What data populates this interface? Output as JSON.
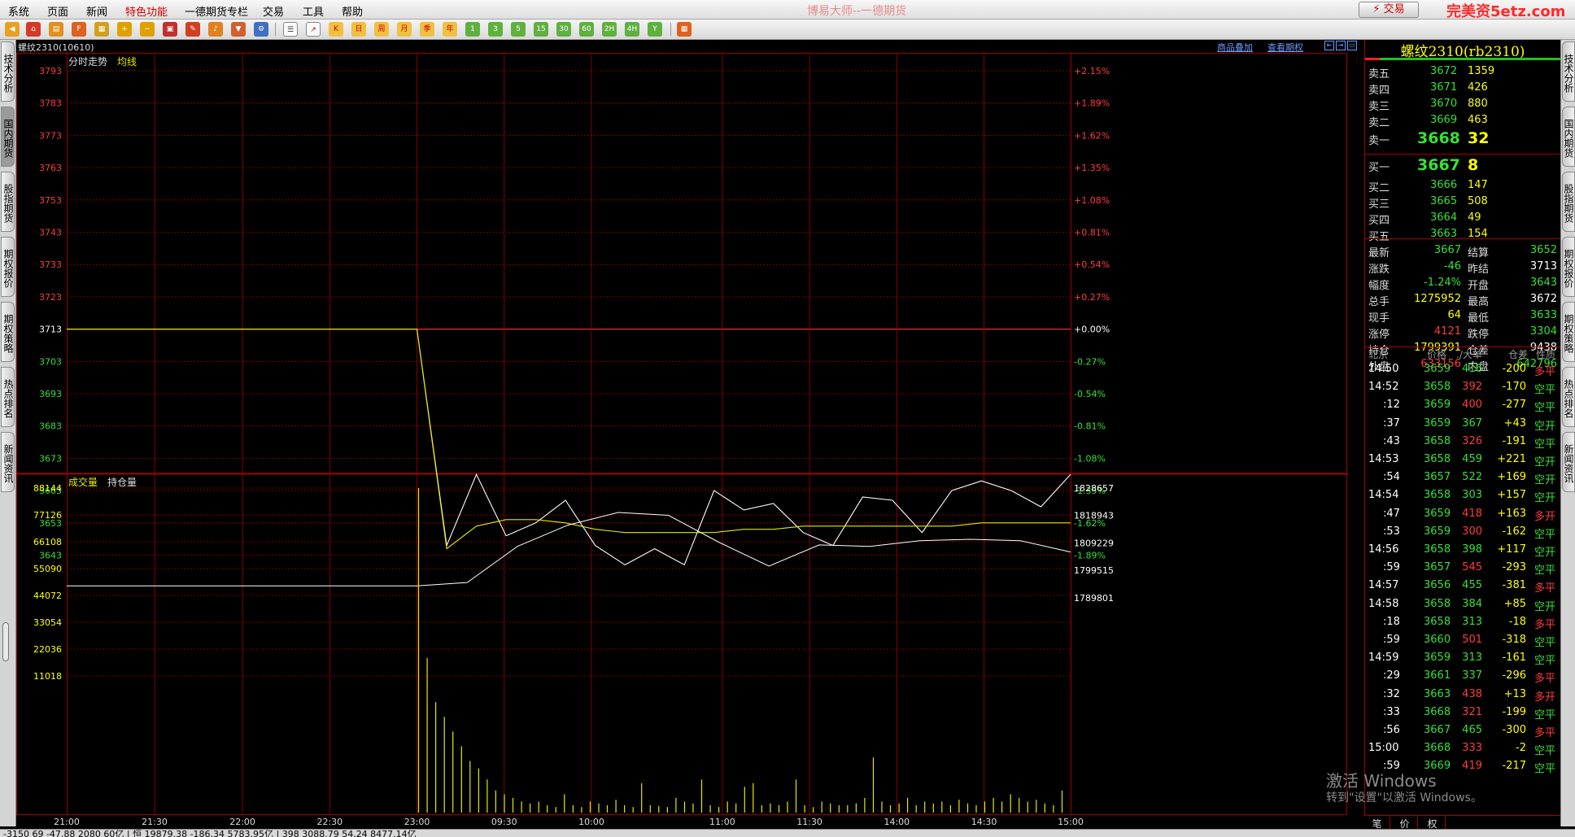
{
  "window": {
    "title": "博易大师--一德期货",
    "trade_button": "⚡ 交易",
    "watermark": "完美资5etz.com"
  },
  "menu": [
    "系统",
    "页面",
    "新闻",
    "特色功能",
    "一德期货专栏",
    "交易",
    "工具",
    "帮助"
  ],
  "toolbar": {
    "period_buttons": [
      "日",
      "周",
      "月",
      "季",
      "年",
      "1",
      "3",
      "5",
      "15",
      "30",
      "60",
      "2H",
      "4H",
      "Y"
    ]
  },
  "left_tabs": [
    "技术分析",
    "国内期货",
    "股指期货",
    "期权报价",
    "期权策略",
    "热点排名",
    "新闻资讯"
  ],
  "right_tabs": [
    "技术分析",
    "国内期货",
    "股指期货",
    "期权报价",
    "期权策略",
    "热点排名",
    "新闻资讯"
  ],
  "chart": {
    "symbol_label": "螺纹2310(10610)",
    "links": [
      "商品叠加",
      "查看期权"
    ],
    "price_panel": {
      "legend": [
        "分时走势",
        "均线"
      ],
      "left_ticks": [
        "3793",
        "3783",
        "3773",
        "3763",
        "3753",
        "3743",
        "3733",
        "3723",
        "3713",
        "3703",
        "3693",
        "3683",
        "3673",
        "3663",
        "3653",
        "3643"
      ],
      "right_ticks": [
        "+2.15%",
        "+1.89%",
        "+1.62%",
        "+1.35%",
        "+1.08%",
        "+0.81%",
        "+0.54%",
        "+0.27%",
        "+0.00%",
        "-0.27%",
        "-0.54%",
        "-0.81%",
        "-1.08%",
        "-1.35%",
        "-1.62%",
        "-1.89%"
      ],
      "prev_settle": 3713
    },
    "volume_panel": {
      "legend": [
        "成交量",
        "持仓量"
      ],
      "left_ticks": [
        "88144",
        "77126",
        "66108",
        "55090",
        "44072",
        "33054",
        "22036",
        "11018"
      ],
      "right_ticks": [
        "1828657",
        "1818943",
        "1809229",
        "1799515",
        "1789801"
      ]
    },
    "time_ticks": [
      "21:00",
      "21:30",
      "22:00",
      "22:30",
      "23:00",
      "09:30",
      "10:00",
      "11:00",
      "11:30",
      "14:00",
      "14:30",
      "15:00"
    ]
  },
  "chart_data": {
    "type": "line",
    "title": "",
    "x_categories": [
      "21:00",
      "21:30",
      "22:00",
      "22:30",
      "23:00",
      "09:30",
      "10:00",
      "11:00",
      "11:30",
      "14:00",
      "14:30",
      "15:00"
    ],
    "series": [
      {
        "name": "分时走势",
        "values": [
          3713,
          3713,
          3713,
          3713,
          3713,
          3646,
          3668,
          3649,
          3653,
          3660,
          3646,
          3640,
          3645,
          3640,
          3663,
          3657,
          3659,
          3650,
          3646,
          3661,
          3660,
          3650,
          3663,
          3666,
          3663,
          3658,
          3668
        ]
      },
      {
        "name": "均线",
        "values": [
          3713,
          3713,
          3713,
          3713,
          3713,
          3645,
          3652,
          3654,
          3654,
          3653,
          3651,
          3650,
          3650,
          3650,
          3650,
          3651,
          3651,
          3652,
          3652,
          3652,
          3652,
          3652,
          3652,
          3653,
          3653,
          3653,
          3653
        ]
      },
      {
        "name": "持仓量",
        "values": [
          1794000,
          1794000,
          1794000,
          1794000,
          1794000,
          1795200,
          1808000,
          1815500,
          1820000,
          1819000,
          1809500,
          1801000,
          1808500,
          1808000,
          1810000,
          1810500,
          1810000,
          1806000
        ]
      }
    ],
    "volume_bars": [
      88144,
      42000,
      30000,
      26000,
      22000,
      18000,
      14000,
      12000,
      9000,
      6000,
      5000,
      4000,
      3000,
      2500,
      3000,
      2000,
      1500,
      5000,
      2000,
      1500,
      3000,
      2500,
      2000,
      3500,
      2000,
      1500,
      8000,
      2000,
      1800,
      1500,
      4000,
      3000,
      2500,
      9000,
      2000,
      1500,
      3000,
      2500,
      7000,
      8000,
      2000,
      2500,
      2000,
      3000,
      9000,
      2000,
      1500,
      3000,
      2500,
      2000,
      2000,
      2500,
      4000,
      15000,
      3000,
      2000,
      2500,
      4000,
      2000,
      3000,
      2500,
      3000,
      2000,
      3500,
      2500,
      2000,
      3000,
      4000,
      3000,
      5000,
      4000,
      3000,
      3500,
      2500,
      2000,
      6000
    ],
    "price_ylim": [
      3640,
      3793
    ],
    "volume_ylim": [
      0,
      88144
    ],
    "oi_ylim": [
      1789801,
      1828657
    ]
  },
  "quote": {
    "title": "螺纹2310(rb2310)",
    "asks": [
      {
        "label": "卖五",
        "price": "3672",
        "vol": "1359"
      },
      {
        "label": "卖四",
        "price": "3671",
        "vol": "426"
      },
      {
        "label": "卖三",
        "price": "3670",
        "vol": "880"
      },
      {
        "label": "卖二",
        "price": "3669",
        "vol": "463"
      },
      {
        "label": "卖一",
        "price": "3668",
        "vol": "32"
      }
    ],
    "bids": [
      {
        "label": "买一",
        "price": "3667",
        "vol": "8"
      },
      {
        "label": "买二",
        "price": "3666",
        "vol": "147"
      },
      {
        "label": "买三",
        "price": "3665",
        "vol": "508"
      },
      {
        "label": "买四",
        "price": "3664",
        "vol": "49"
      },
      {
        "label": "买五",
        "price": "3663",
        "vol": "154"
      }
    ],
    "stats": [
      {
        "l1": "最新",
        "v1": "3667",
        "l2": "结算",
        "v2": "3652"
      },
      {
        "l1": "涨跌",
        "v1": "-46",
        "l2": "昨结",
        "v2": "3713"
      },
      {
        "l1": "幅度",
        "v1": "-1.24%",
        "l2": "开盘",
        "v2": "3643"
      },
      {
        "l1": "总手",
        "v1": "1275952",
        "l2": "最高",
        "v2": "3672"
      },
      {
        "l1": "现手",
        "v1": "64",
        "l2": "最低",
        "v2": "3633"
      },
      {
        "l1": "涨停",
        "v1": "4121",
        "l2": "跌停",
        "v2": "3304"
      },
      {
        "l1": "持仓",
        "v1": "1799391",
        "l2": "仓差",
        "v2": "9438"
      },
      {
        "l1": "外盘",
        "v1": "633156",
        "l2": "内盘",
        "v2": "642796"
      }
    ],
    "ticks_header": [
      "北京",
      "价格",
      "./大单",
      "仓差",
      "性质"
    ],
    "ticks": [
      {
        "t": "14:50",
        "p": "3659",
        "v": "416",
        "d": "-200",
        "n": "多平"
      },
      {
        "t": "14:52",
        "p": "3658",
        "v": "392",
        "d": "-170",
        "n": "空平"
      },
      {
        "t": ":12",
        "p": "3659",
        "v": "400",
        "d": "-277",
        "n": "空平"
      },
      {
        "t": ":37",
        "p": "3659",
        "v": "367",
        "d": "+43",
        "n": "空开"
      },
      {
        "t": ":43",
        "p": "3658",
        "v": "326",
        "d": "-191",
        "n": "空平"
      },
      {
        "t": "14:53",
        "p": "3658",
        "v": "459",
        "d": "+221",
        "n": "空开"
      },
      {
        "t": ":54",
        "p": "3657",
        "v": "522",
        "d": "+169",
        "n": "空开"
      },
      {
        "t": "14:54",
        "p": "3658",
        "v": "303",
        "d": "+157",
        "n": "空开"
      },
      {
        "t": ":47",
        "p": "3659",
        "v": "418",
        "d": "+163",
        "n": "多开"
      },
      {
        "t": ":53",
        "p": "3659",
        "v": "300",
        "d": "-162",
        "n": "空平"
      },
      {
        "t": "14:56",
        "p": "3658",
        "v": "398",
        "d": "+117",
        "n": "空开"
      },
      {
        "t": ":59",
        "p": "3657",
        "v": "545",
        "d": "-293",
        "n": "空平"
      },
      {
        "t": "14:57",
        "p": "3656",
        "v": "455",
        "d": "-381",
        "n": "多平"
      },
      {
        "t": "14:58",
        "p": "3658",
        "v": "384",
        "d": "+85",
        "n": "空开"
      },
      {
        "t": ":18",
        "p": "3658",
        "v": "313",
        "d": "-18",
        "n": "多平"
      },
      {
        "t": ":59",
        "p": "3660",
        "v": "501",
        "d": "-318",
        "n": "空平"
      },
      {
        "t": "14:59",
        "p": "3659",
        "v": "313",
        "d": "-161",
        "n": "空平"
      },
      {
        "t": ":29",
        "p": "3661",
        "v": "337",
        "d": "-296",
        "n": "多平"
      },
      {
        "t": ":32",
        "p": "3663",
        "v": "438",
        "d": "+13",
        "n": "多开"
      },
      {
        "t": ":33",
        "p": "3668",
        "v": "321",
        "d": "-199",
        "n": "空平"
      },
      {
        "t": ":56",
        "p": "3667",
        "v": "465",
        "d": "-300",
        "n": "多平"
      },
      {
        "t": "15:00",
        "p": "3668",
        "v": "333",
        "d": "-2",
        "n": "空平"
      },
      {
        "t": ":59",
        "p": "3669",
        "v": "419",
        "d": "-217",
        "n": "空平"
      }
    ],
    "bottom_tabs": [
      "笔",
      "价",
      "权"
    ]
  },
  "status": "-3150 69 -47.88 2080 60亿 | 恒 19879.38 -186.34 5783.95亿 | 398 3088.79 54.24 8477.14亿",
  "activation": {
    "line1": "激活 Windows",
    "line2": "转到\"设置\"以激活 Windows。"
  },
  "colors": {
    "up": "#ff3c3c",
    "down": "#38e038",
    "price_line": "#ffffff",
    "avg_line": "#e8e800",
    "grid": "#a00000",
    "volume": "#e8e800"
  }
}
